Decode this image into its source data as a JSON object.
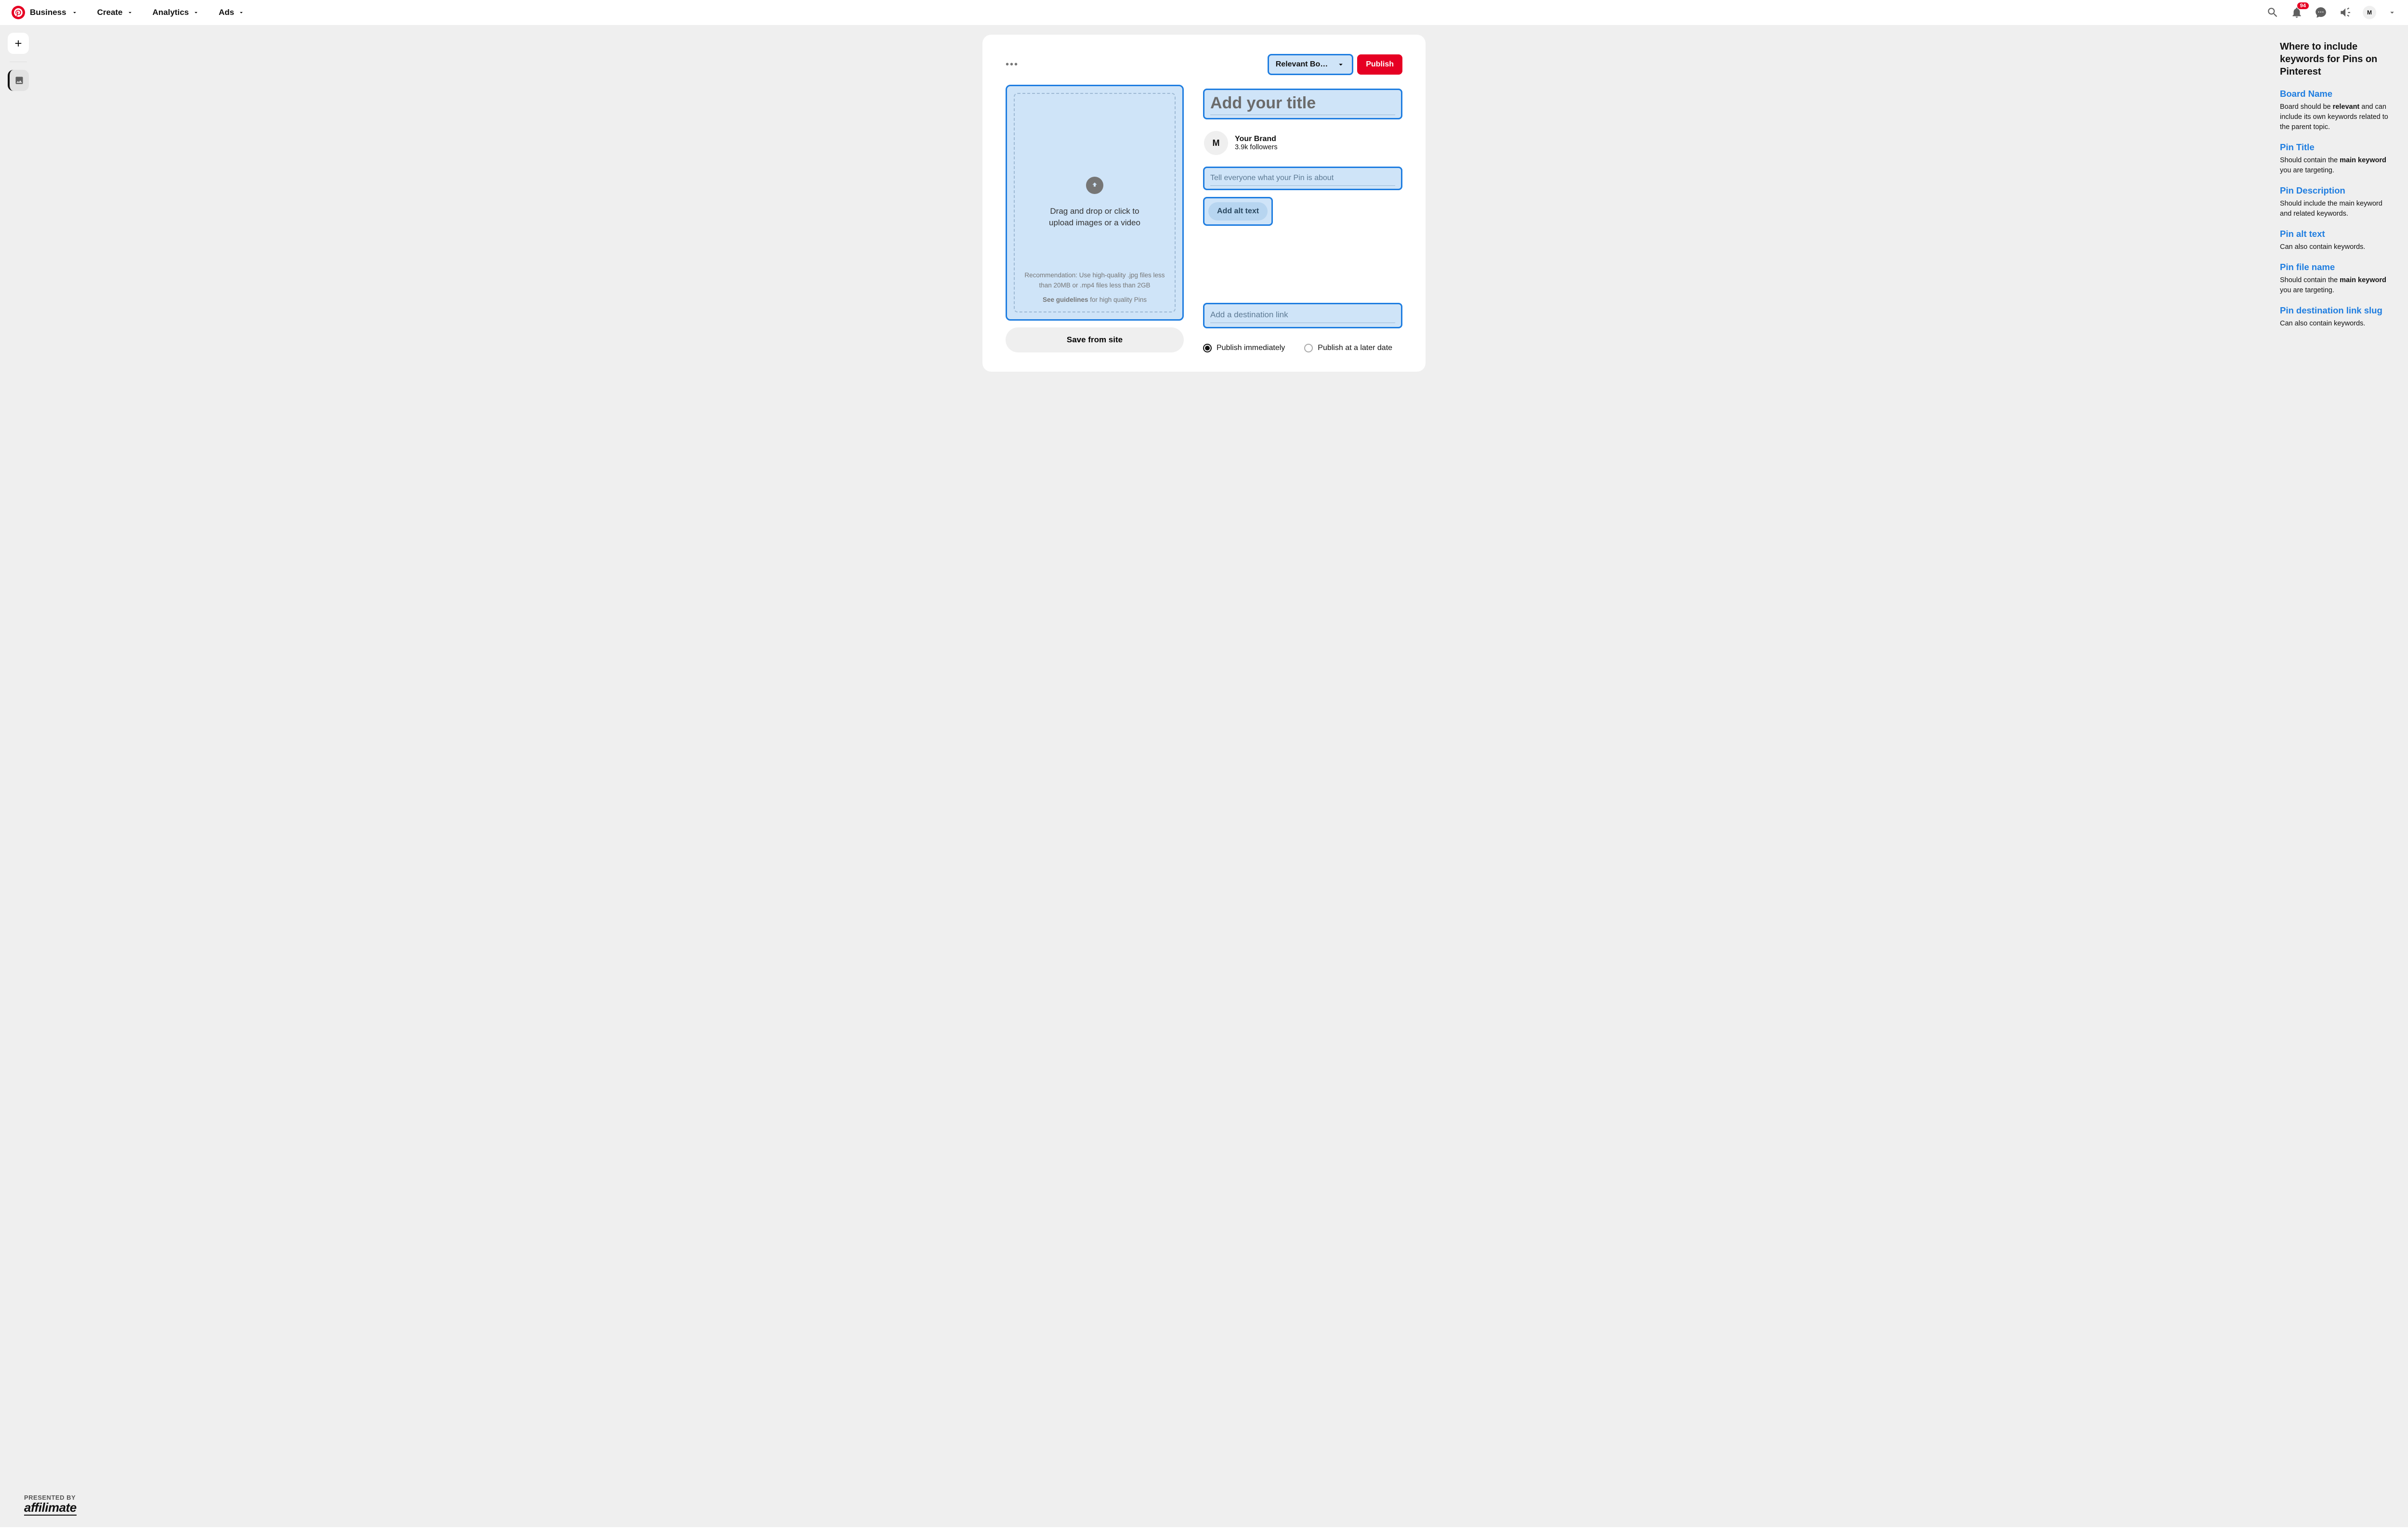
{
  "header": {
    "nav": [
      "Business",
      "Create",
      "Analytics",
      "Ads"
    ],
    "notification_count": "94",
    "avatar_initial": "M"
  },
  "builder": {
    "board_select_label": "Relevant Bo…",
    "publish_label": "Publish",
    "upload": {
      "main_text": "Drag and drop or click to upload images or a video",
      "recommendation": "Recommendation: Use high-quality .jpg files less than 20MB or .mp4 files less than 2GB",
      "guidelines_bold": "See guidelines",
      "guidelines_rest": " for high quality Pins"
    },
    "save_from_site": "Save from site",
    "title_placeholder": "Add your title",
    "brand": {
      "initial": "M",
      "name": "Your Brand",
      "followers": "3.9k followers"
    },
    "desc_placeholder": "Tell everyone what your Pin is about",
    "alt_text_label": "Add alt text",
    "link_placeholder": "Add a destination link",
    "publish_immediately": "Publish immediately",
    "publish_later": "Publish at a later date"
  },
  "sidebar": {
    "title": "Where to include keywords for Pins on Pinterest",
    "items": [
      {
        "title": "Board Name",
        "desc_pre": "Board should be ",
        "desc_bold": "relevant",
        "desc_post": " and can include its own keywords related to the parent topic."
      },
      {
        "title": "Pin Title",
        "desc_pre": "Should contain the ",
        "desc_bold": "main keyword",
        "desc_post": " you are targeting."
      },
      {
        "title": "Pin Description",
        "desc_pre": "",
        "desc_bold": "",
        "desc_post": "Should include the main keyword and related keywords."
      },
      {
        "title": "Pin alt text",
        "desc_pre": "",
        "desc_bold": "",
        "desc_post": "Can also contain keywords."
      },
      {
        "title": "Pin file name",
        "desc_pre": "Should contain the ",
        "desc_bold": "main keyword",
        "desc_post": " you are targeting."
      },
      {
        "title": "Pin destination link slug",
        "desc_pre": "",
        "desc_bold": "",
        "desc_post": "Can also contain keywords."
      }
    ]
  },
  "presented": {
    "label": "PRESENTED BY",
    "brand": "affilimate"
  }
}
